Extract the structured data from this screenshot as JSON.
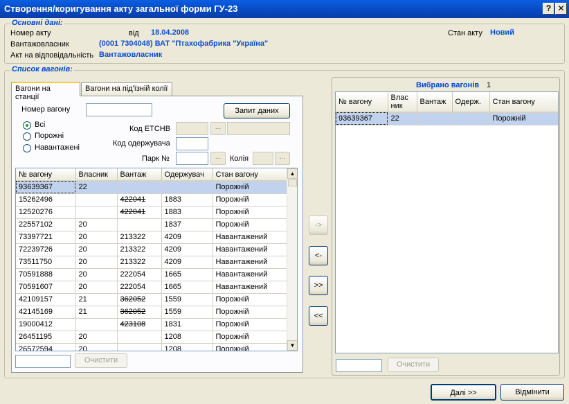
{
  "window": {
    "title": "Створення/коригування акту загальної форми ГУ-23",
    "help_label": "?",
    "close_label": "✕"
  },
  "basic": {
    "group_title": "Основні дані:",
    "act_number_label": "Номер акту",
    "date_label": "від",
    "date_value": "18.04.2008",
    "owner_label": "Вантажовласник",
    "owner_value": "(0001 7304048) ВАТ \"Птахофабрика \"Україна\"",
    "responsible_label": "Акт на відповідальність",
    "responsible_value": "Вантажовласник",
    "state_label": "Стан акту",
    "state_value": "Новий"
  },
  "wagons": {
    "group_title": "Список вагонів:",
    "tabs": [
      {
        "label": "Вагони на станції"
      },
      {
        "label": "Вагони на під'їзній колії"
      }
    ],
    "wagon_number_label": "Номер вагону",
    "wagon_number_value": "",
    "request_button": "Запит даних",
    "radios": [
      {
        "label": "Всі",
        "checked": true
      },
      {
        "label": "Порожні",
        "checked": false
      },
      {
        "label": "Навантажені",
        "checked": false
      }
    ],
    "etsnv_label": "Код ЕТСНВ",
    "receiver_code_label": "Код одержувача",
    "park_label": "Парк №",
    "track_label": "Колія",
    "ellipsis": "...",
    "columns": [
      "№ вагону",
      "Власник",
      "Вантаж",
      "Одержувач",
      "Стан вагону"
    ],
    "rows": [
      {
        "num": "93639367",
        "owner": "22",
        "cargo": "",
        "receiver": "",
        "state": "Порожній",
        "strike": false
      },
      {
        "num": "15262496",
        "owner": "",
        "cargo": "422041",
        "receiver": "1883",
        "state": "Порожній",
        "strike": true
      },
      {
        "num": "12520276",
        "owner": "",
        "cargo": "422041",
        "receiver": "1883",
        "state": "Порожній",
        "strike": true
      },
      {
        "num": "22557102",
        "owner": "20",
        "cargo": "",
        "receiver": "1837",
        "state": "Порожній",
        "strike": false
      },
      {
        "num": "73397721",
        "owner": "20",
        "cargo": "213322",
        "receiver": "4209",
        "state": "Навантажений",
        "strike": false
      },
      {
        "num": "72239726",
        "owner": "20",
        "cargo": "213322",
        "receiver": "4209",
        "state": "Навантажений",
        "strike": false
      },
      {
        "num": "73511750",
        "owner": "20",
        "cargo": "213322",
        "receiver": "4209",
        "state": "Навантажений",
        "strike": false
      },
      {
        "num": "70591888",
        "owner": "20",
        "cargo": "222054",
        "receiver": "1665",
        "state": "Навантажений",
        "strike": false
      },
      {
        "num": "70591607",
        "owner": "20",
        "cargo": "222054",
        "receiver": "1665",
        "state": "Навантажений",
        "strike": false
      },
      {
        "num": "42109157",
        "owner": "21",
        "cargo": "362052",
        "receiver": "1559",
        "state": "Порожній",
        "strike": true
      },
      {
        "num": "42145169",
        "owner": "21",
        "cargo": "362052",
        "receiver": "1559",
        "state": "Порожній",
        "strike": true
      },
      {
        "num": "19000412",
        "owner": "",
        "cargo": "423108",
        "receiver": "1831",
        "state": "Порожній",
        "strike": true
      },
      {
        "num": "26451195",
        "owner": "20",
        "cargo": "",
        "receiver": "1208",
        "state": "Порожній",
        "strike": false
      },
      {
        "num": "26572594",
        "owner": "20",
        "cargo": "",
        "receiver": "1208",
        "state": "Порожній",
        "strike": false
      }
    ],
    "filter_value": "",
    "clear_button": "Очистити"
  },
  "selected": {
    "title": "Вибрано вагонів",
    "count": "1",
    "columns": [
      "№ вагону",
      "Влас ник",
      "Вантаж",
      "Одерж.",
      "Стан вагону"
    ],
    "rows": [
      {
        "num": "93639367",
        "owner": "22",
        "cargo": "",
        "receiver": "",
        "state": "Порожній"
      }
    ],
    "filter_value": "",
    "clear_button": "Очистити"
  },
  "transfer": {
    "add": "->",
    "remove": "<-",
    "add_all": ">>",
    "remove_all": "<<"
  },
  "footer": {
    "next_button": "Далі >>",
    "cancel_button": "Відмінити"
  }
}
